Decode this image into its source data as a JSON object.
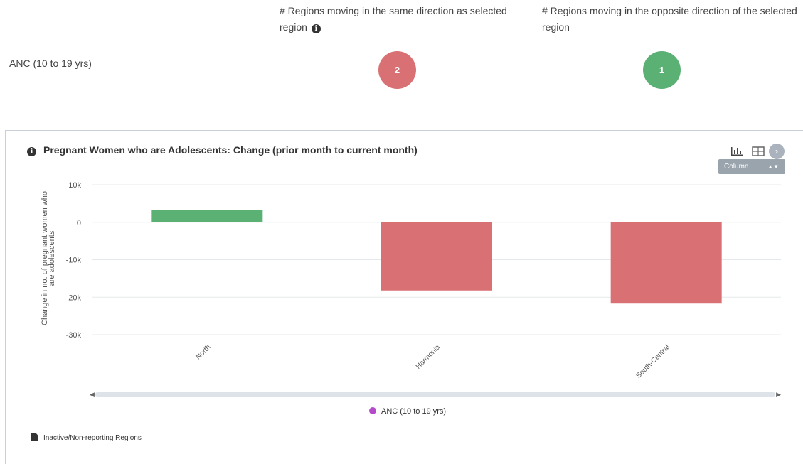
{
  "summary": {
    "header_same": "# Regions moving in the same direction as selected region",
    "header_opposite": "# Regions moving in the opposite direction of the selected region",
    "row_label": "ANC (10 to 19 yrs)",
    "same_count": "2",
    "opposite_count": "1",
    "colors": {
      "same": "#d97073",
      "opposite": "#5bb074"
    }
  },
  "panel": {
    "title": "Pregnant Women who are Adolescents: Change (prior month to current month)",
    "toolbar": {
      "icons": [
        "bar-chart-icon",
        "table-icon",
        "next-icon"
      ],
      "chart_type_selected": "Column"
    },
    "legend_label": "ANC (10 to 19 yrs)",
    "footer_link": "Inactive/Non-reporting Regions"
  },
  "chart_data": {
    "type": "bar",
    "categories": [
      "North",
      "Harmonia",
      "South-Central"
    ],
    "series": [
      {
        "name": "ANC (10 to 19 yrs)",
        "values": [
          3200,
          -18200,
          -21700
        ]
      }
    ],
    "bar_colors": [
      "#5bb074",
      "#d97073",
      "#d97073"
    ],
    "ylabel": "Change in no. of pregnant women who are adolescents",
    "xlabel": "",
    "ylim": [
      -30000,
      10000
    ],
    "y_ticks": [
      "10k",
      "0",
      "-10k",
      "-20k",
      "-30k"
    ],
    "y_tick_values": [
      10000,
      0,
      -10000,
      -20000,
      -30000
    ],
    "grid": true,
    "legend": "bottom"
  }
}
